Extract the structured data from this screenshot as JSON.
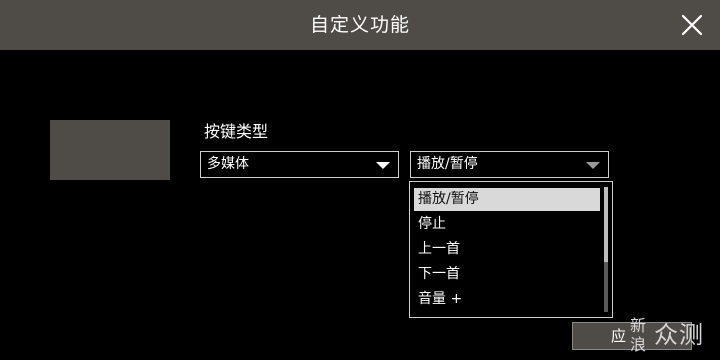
{
  "window": {
    "title": "自定义功能"
  },
  "form": {
    "key_type_label": "按键类型",
    "key_type_value": "多媒体",
    "function_value": "播放/暂停"
  },
  "dropdown": {
    "options": [
      {
        "label": "播放/暂停",
        "selected": true
      },
      {
        "label": "停止",
        "selected": false
      },
      {
        "label": "上一首",
        "selected": false
      },
      {
        "label": "下一首",
        "selected": false
      },
      {
        "label": "音量 +",
        "selected": false
      }
    ]
  },
  "footer": {
    "apply_label": "应"
  },
  "watermark": {
    "site_left": "新浪",
    "site_right": "众测"
  },
  "colors": {
    "titlebar": "#4f4c47",
    "background": "#000000",
    "selected_option_bg": "#d9d9d9"
  },
  "icons": {
    "close": "close-icon",
    "dropdown_arrow": "chevron-down-icon"
  }
}
